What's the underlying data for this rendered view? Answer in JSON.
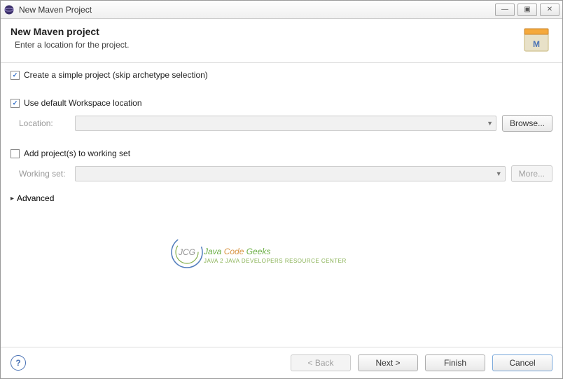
{
  "window": {
    "title": "New Maven Project",
    "buttons": {
      "minimize": "—",
      "maximize": "▣",
      "close": "✕"
    }
  },
  "header": {
    "title": "New Maven project",
    "subtitle": "Enter a location for the project."
  },
  "options": {
    "simpleProject": {
      "label": "Create a simple project (skip archetype selection)",
      "checked": true
    },
    "useDefaultLocation": {
      "label": "Use default Workspace location",
      "checked": true
    },
    "addToWorkingSet": {
      "label": "Add project(s) to working set",
      "checked": false
    }
  },
  "fields": {
    "location": {
      "label": "Location:",
      "value": "",
      "browse": "Browse..."
    },
    "workingSet": {
      "label": "Working set:",
      "value": "",
      "more": "More..."
    }
  },
  "advanced": {
    "label": "Advanced"
  },
  "footer": {
    "back": "< Back",
    "next": "Next >",
    "finish": "Finish",
    "cancel": "Cancel"
  },
  "watermark": {
    "brand1": "Java ",
    "brand2": "Code ",
    "brand3": "Geeks",
    "tagline": "JAVA 2 JAVA DEVELOPERS RESOURCE CENTER",
    "badge": "JCG"
  }
}
